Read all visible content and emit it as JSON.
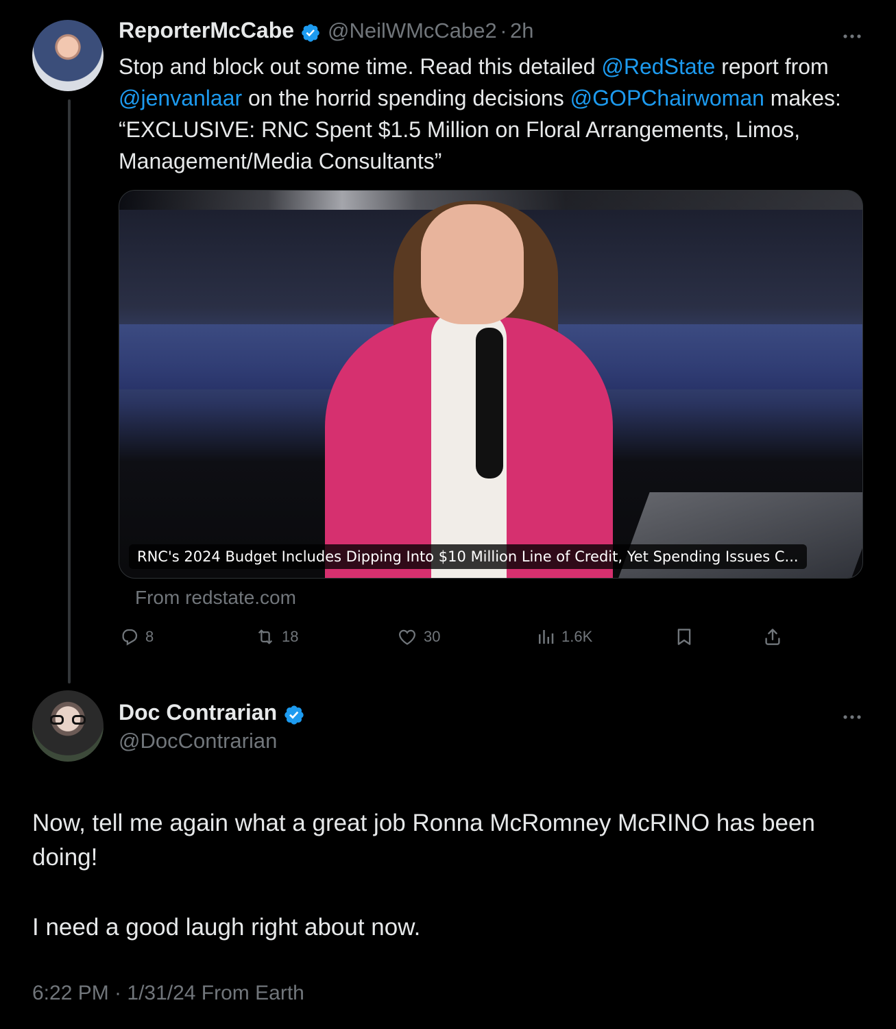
{
  "original_tweet": {
    "display_name": "ReporterMcCabe",
    "handle": "@NeilWMcCabe2",
    "time_ago": "2h",
    "text_parts": {
      "t1": "Stop and block out some time. Read this detailed ",
      "m1": "@RedState",
      "t2": " report from ",
      "m2": "@jenvanlaar",
      "t3": " on the horrid spending decisions ",
      "m3": "@GOPChairwoman",
      "t4": " makes: “EXCLUSIVE: RNC Spent $1.5 Million on Floral Arrangements, Limos, Management/Media Consultants”"
    },
    "card": {
      "caption": "RNC's 2024 Budget Includes Dipping Into $10 Million Line of Credit, Yet Spending Issues C...",
      "source": "From redstate.com"
    },
    "actions": {
      "replies": "8",
      "reposts": "18",
      "likes": "30",
      "views": "1.6K"
    },
    "icons": [
      "verified-badge-icon",
      "more-icon",
      "reply-icon",
      "repost-icon",
      "like-icon",
      "views-icon",
      "bookmark-icon",
      "share-icon"
    ]
  },
  "reply_tweet": {
    "display_name": "Doc Contrarian",
    "handle": "@DocContrarian",
    "paragraph1": "Now, tell me again what a great job Ronna McRomney McRINO has been doing!",
    "paragraph2": "I need a good laugh right about now.",
    "timestamp": "6:22 PM · 1/31/24 From Earth"
  },
  "colors": {
    "background": "#000000",
    "text": "#e7e9ea",
    "muted": "#71767b",
    "link": "#1d9bf0",
    "verified": "#1d9bf0"
  }
}
